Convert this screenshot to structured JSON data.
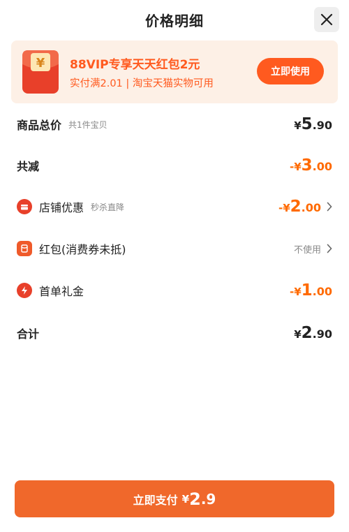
{
  "header": {
    "title": "价格明细"
  },
  "promo": {
    "title": "88VIP专享天天红包2元",
    "subtitle": "实付满2.01 | 淘宝天猫实物可用",
    "button_label": "立即使用",
    "icon_glyph": "¥",
    "accent_color": "#ff5a1f"
  },
  "rows": {
    "goods_total": {
      "label": "商品总价",
      "note": "共1件宝贝",
      "currency": "¥",
      "int": "5",
      "dec": ".90"
    },
    "total_reduction": {
      "label": "共减",
      "currency": "-¥",
      "int": "3",
      "dec": ".00"
    },
    "store_discount": {
      "label": "店铺优惠",
      "note": "秒杀直降",
      "currency": "-¥",
      "int": "2",
      "dec": ".00",
      "icon": "store-icon"
    },
    "red_packet": {
      "label": "红包(消费券未抵)",
      "status": "不使用",
      "icon": "red-packet-icon"
    },
    "first_order": {
      "label": "首单礼金",
      "currency": "-¥",
      "int": "1",
      "dec": ".00",
      "icon": "lightning-icon"
    },
    "grand_total": {
      "label": "合计",
      "currency": "¥",
      "int": "2",
      "dec": ".90"
    }
  },
  "pay_button": {
    "label": "立即支付",
    "currency": "¥",
    "int": "2",
    "dec": ".9",
    "color": "#f0682b"
  }
}
